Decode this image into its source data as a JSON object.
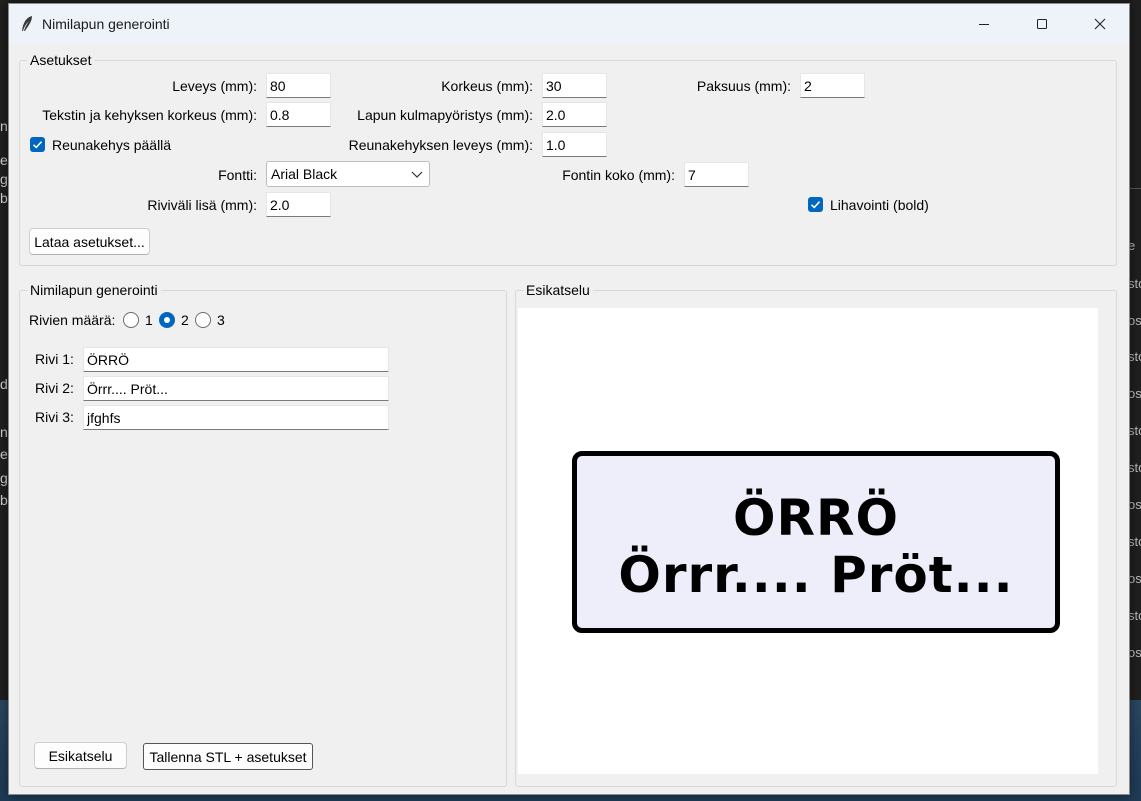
{
  "window": {
    "title": "Nimilapun generointi"
  },
  "settings": {
    "group_title": "Asetukset",
    "width_label": "Leveys (mm):",
    "width_value": "80",
    "height_label": "Korkeus (mm):",
    "height_value": "30",
    "thickness_label": "Paksuus (mm):",
    "thickness_value": "2",
    "text_frame_height_label": "Tekstin ja kehyksen korkeus (mm):",
    "text_frame_height_value": "0.8",
    "corner_radius_label": "Lapun kulmapyöristys (mm):",
    "corner_radius_value": "2.0",
    "border_enabled_label": "Reunakehys päällä",
    "border_enabled": true,
    "border_width_label": "Reunakehyksen leveys (mm):",
    "border_width_value": "1.0",
    "font_label": "Fontti:",
    "font_value": "Arial Black",
    "font_size_label": "Fontin koko (mm):",
    "font_size_value": "7",
    "line_spacing_label": "Riviväli lisä (mm):",
    "line_spacing_value": "2.0",
    "bold_label": "Lihavointi (bold)",
    "bold": true,
    "load_button": "Lataa asetukset..."
  },
  "generation": {
    "group_title": "Nimilapun generointi",
    "row_count_label": "Rivien määrä:",
    "row_options": [
      "1",
      "2",
      "3"
    ],
    "row_selected": "2",
    "rows": [
      {
        "label": "Rivi 1:",
        "value": "ÖRRÖ"
      },
      {
        "label": "Rivi 2:",
        "value": "Örrr.... Pröt..."
      },
      {
        "label": "Rivi 3:",
        "value": "jfghfs"
      }
    ],
    "preview_button": "Esikatselu",
    "save_button": "Tallenna STL + asetukset"
  },
  "preview": {
    "group_title": "Esikatselu",
    "lines": [
      "ÖRRÖ",
      "Örrr.... Pröt..."
    ],
    "colors": {
      "plate_fill": "#eeeefa",
      "plate_border": "#000000",
      "text": "#000000"
    }
  },
  "background": {
    "left_letters": [
      "n",
      "e",
      "g",
      "b",
      "d",
      "n",
      "e",
      "g",
      "b"
    ],
    "right_fragments": [
      "e",
      "sto",
      "os",
      "sto",
      "os",
      "sto",
      "sto",
      "os",
      "sto",
      "os",
      "sto",
      "os"
    ]
  },
  "colors": {
    "accent": "#0067c0",
    "window_bg": "#f0f0f0",
    "titlebar_bg": "#eef3fa"
  }
}
